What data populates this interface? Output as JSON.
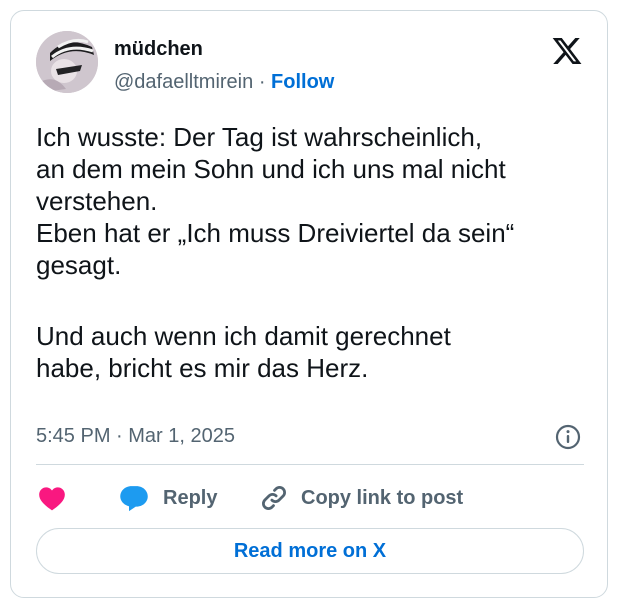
{
  "author": {
    "display_name": "müdchen",
    "handle": "@dafaelltmirein",
    "separator": "·",
    "follow_label": "Follow"
  },
  "brand_icon": "x-logo-icon",
  "tweet": {
    "lines": [
      "Ich wusste: Der Tag ist wahrscheinlich,",
      "an dem mein Sohn und ich uns mal nicht",
      "verstehen.",
      "Eben hat er „Ich muss Dreiviertel da sein“",
      "gesagt.",
      "Und auch wenn ich damit gerechnet",
      "habe, bricht es mir das Herz."
    ],
    "timestamp": "5:45 PM · Mar 1, 2025"
  },
  "actions": {
    "like_icon": "heart-icon",
    "reply_label": "Reply",
    "reply_icon": "speech-bubble-icon",
    "copy_label": "Copy link to post",
    "copy_icon": "link-icon"
  },
  "read_more_label": "Read more on X",
  "colors": {
    "text": "#0f1419",
    "secondary": "#536471",
    "link": "#006fd6",
    "like": "#f91880",
    "reply": "#1d9bf0",
    "border": "#cfd9de"
  }
}
